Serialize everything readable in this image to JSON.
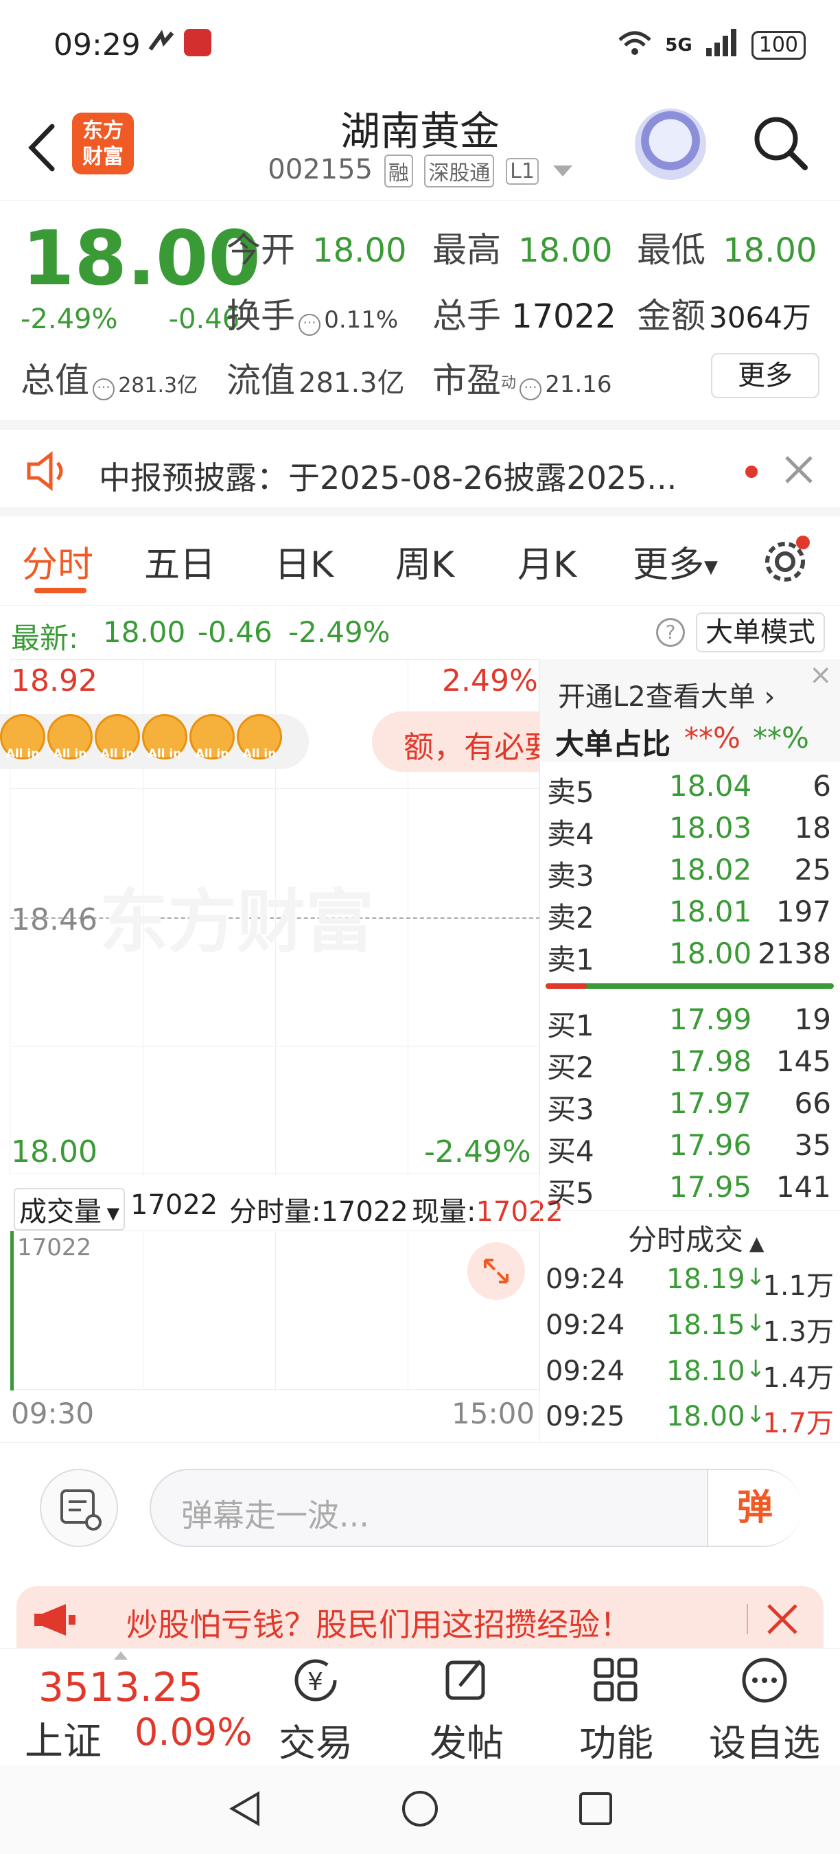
{
  "status": {
    "time": "09:29",
    "network": "5G",
    "battery": "100"
  },
  "header": {
    "logo_line1": "东方",
    "logo_line2": "财富",
    "title": "湖南黄金",
    "code": "002155",
    "tags": [
      "融",
      "深股通",
      "L1"
    ]
  },
  "quote": {
    "price": "18.00",
    "pct": "-2.49%",
    "chg": "-0.46",
    "open_label": "今开",
    "open": "18.00",
    "high_label": "最高",
    "high": "18.00",
    "low_label": "最低",
    "low": "18.00",
    "turnover_label": "换手",
    "turnover": "0.11%",
    "volume_label": "总手",
    "volume": "17022",
    "amount_label": "金额",
    "amount": "3064万",
    "mcap_label": "总值",
    "mcap": "281.3亿",
    "float_label": "流值",
    "float": "281.3亿",
    "pe_label": "市盈",
    "pe_sup": "动",
    "pe": "21.16",
    "more": "更多"
  },
  "notice": {
    "text": "中报预披露：于2025-08-26披露2025..."
  },
  "tabs": [
    "分时",
    "五日",
    "日K",
    "周K",
    "月K",
    "更多"
  ],
  "latest": {
    "label": "最新:",
    "price": "18.00",
    "chg": "-0.46",
    "pct": "-2.49%",
    "mode": "大单模式"
  },
  "chart": {
    "top_price": "18.92",
    "top_pct": "2.49%",
    "mid_price": "18.46",
    "bottom_price": "18.00",
    "bottom_pct": "-2.49%",
    "badge": "All in",
    "watermark": "东方财富",
    "banner": "额，有必要",
    "vol_label": "成交量",
    "vol": "17022",
    "tick_vol_label": "分时量:",
    "tick_vol": "17022",
    "cur_vol_label": "现量:",
    "cur_vol": "17022",
    "vol_axis": "17022",
    "time_start": "09:30",
    "time_end": "15:00"
  },
  "orderbook": {
    "l2": "开通L2查看大单",
    "big_label": "大单占比",
    "big1": "**%",
    "big2": "**%",
    "asks": [
      {
        "n": "卖5",
        "p": "18.04",
        "v": "6"
      },
      {
        "n": "卖4",
        "p": "18.03",
        "v": "18"
      },
      {
        "n": "卖3",
        "p": "18.02",
        "v": "25"
      },
      {
        "n": "卖2",
        "p": "18.01",
        "v": "197"
      },
      {
        "n": "卖1",
        "p": "18.00",
        "v": "2138"
      }
    ],
    "bids": [
      {
        "n": "买1",
        "p": "17.99",
        "v": "19"
      },
      {
        "n": "买2",
        "p": "17.98",
        "v": "145"
      },
      {
        "n": "买3",
        "p": "17.97",
        "v": "66"
      },
      {
        "n": "买4",
        "p": "17.96",
        "v": "35"
      },
      {
        "n": "买5",
        "p": "17.95",
        "v": "141"
      }
    ],
    "trades_label": "分时成交",
    "trades": [
      {
        "t": "09:24",
        "p": "18.19",
        "v": "1.1万"
      },
      {
        "t": "09:24",
        "p": "18.15",
        "v": "1.3万"
      },
      {
        "t": "09:24",
        "p": "18.10",
        "v": "1.4万"
      },
      {
        "t": "09:25",
        "p": "18.00",
        "v": "1.7万"
      }
    ]
  },
  "danmu": {
    "placeholder": "弹幕走一波...",
    "send": "弹"
  },
  "ad": {
    "text": "炒股怕亏钱？股民们用这招攒经验！"
  },
  "nav": {
    "index_value": "3513.25",
    "index_name": "上证",
    "index_pct": "0.09%",
    "items": [
      "交易",
      "发帖",
      "功能",
      "设自选"
    ]
  }
}
